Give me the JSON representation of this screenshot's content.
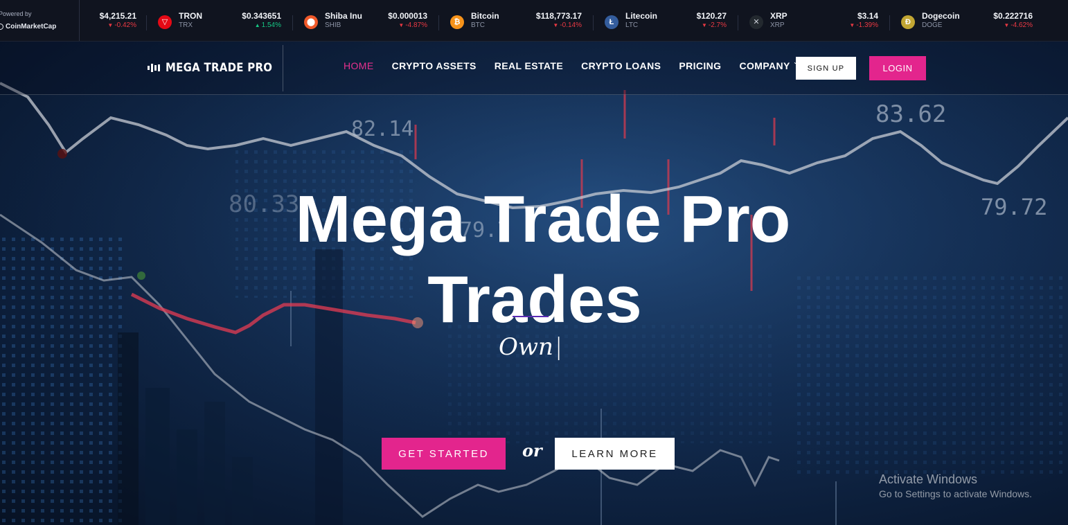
{
  "ticker": {
    "powered_by": "Powered by",
    "provider": "CoinMarketCap",
    "first_item": {
      "price": "$4,215.21",
      "change": "-0.42%",
      "direction": "down"
    },
    "items": [
      {
        "name": "TRON",
        "symbol": "TRX",
        "price": "$0.343651",
        "change": "1.54%",
        "direction": "up",
        "icon": "tron-icon",
        "color": "#e50915"
      },
      {
        "name": "Shiba Inu",
        "symbol": "SHIB",
        "price": "$0.000013",
        "change": "-4.87%",
        "direction": "down",
        "icon": "shiba-icon",
        "color": "#f0592a"
      },
      {
        "name": "Bitcoin",
        "symbol": "BTC",
        "price": "$118,773.17",
        "change": "-0.14%",
        "direction": "down",
        "icon": "bitcoin-icon",
        "color": "#f7931a"
      },
      {
        "name": "Litecoin",
        "symbol": "LTC",
        "price": "$120.27",
        "change": "-2.7%",
        "direction": "down",
        "icon": "litecoin-icon",
        "color": "#345d9d"
      },
      {
        "name": "XRP",
        "symbol": "XRP",
        "price": "$3.14",
        "change": "-1.39%",
        "direction": "down",
        "icon": "xrp-icon",
        "color": "#23292f"
      },
      {
        "name": "Dogecoin",
        "symbol": "DOGE",
        "price": "$0.222716",
        "change": "-4.62%",
        "direction": "down",
        "icon": "dogecoin-icon",
        "color": "#c2a633"
      }
    ]
  },
  "brand": {
    "name": "MEGA TRADE PRO"
  },
  "nav": {
    "items": [
      {
        "label": "HOME",
        "active": true
      },
      {
        "label": "CRYPTO ASSETS",
        "active": false
      },
      {
        "label": "REAL ESTATE",
        "active": false
      },
      {
        "label": "CRYPTO LOANS",
        "active": false
      },
      {
        "label": "PRICING",
        "active": false
      },
      {
        "label": "COMPANY",
        "active": false
      }
    ],
    "signup": "SIGN UP",
    "login": "LOGIN"
  },
  "hero": {
    "line1": "Mega Trade Pro",
    "line2": "Trades",
    "typed": "Own",
    "cursor": "|",
    "cta_primary": "GET STARTED",
    "or": "or",
    "cta_secondary": "LEARN MORE"
  },
  "background_labels": [
    "82.14",
    "83.62",
    "80.33",
    "79.7",
    "79.72"
  ],
  "os_overlay": {
    "title": "Activate Windows",
    "subtitle": "Go to Settings to activate Windows."
  },
  "colors": {
    "accent": "#e3258d",
    "down": "#ea3943",
    "up": "#16c784",
    "ticker_bg": "#10141f"
  }
}
